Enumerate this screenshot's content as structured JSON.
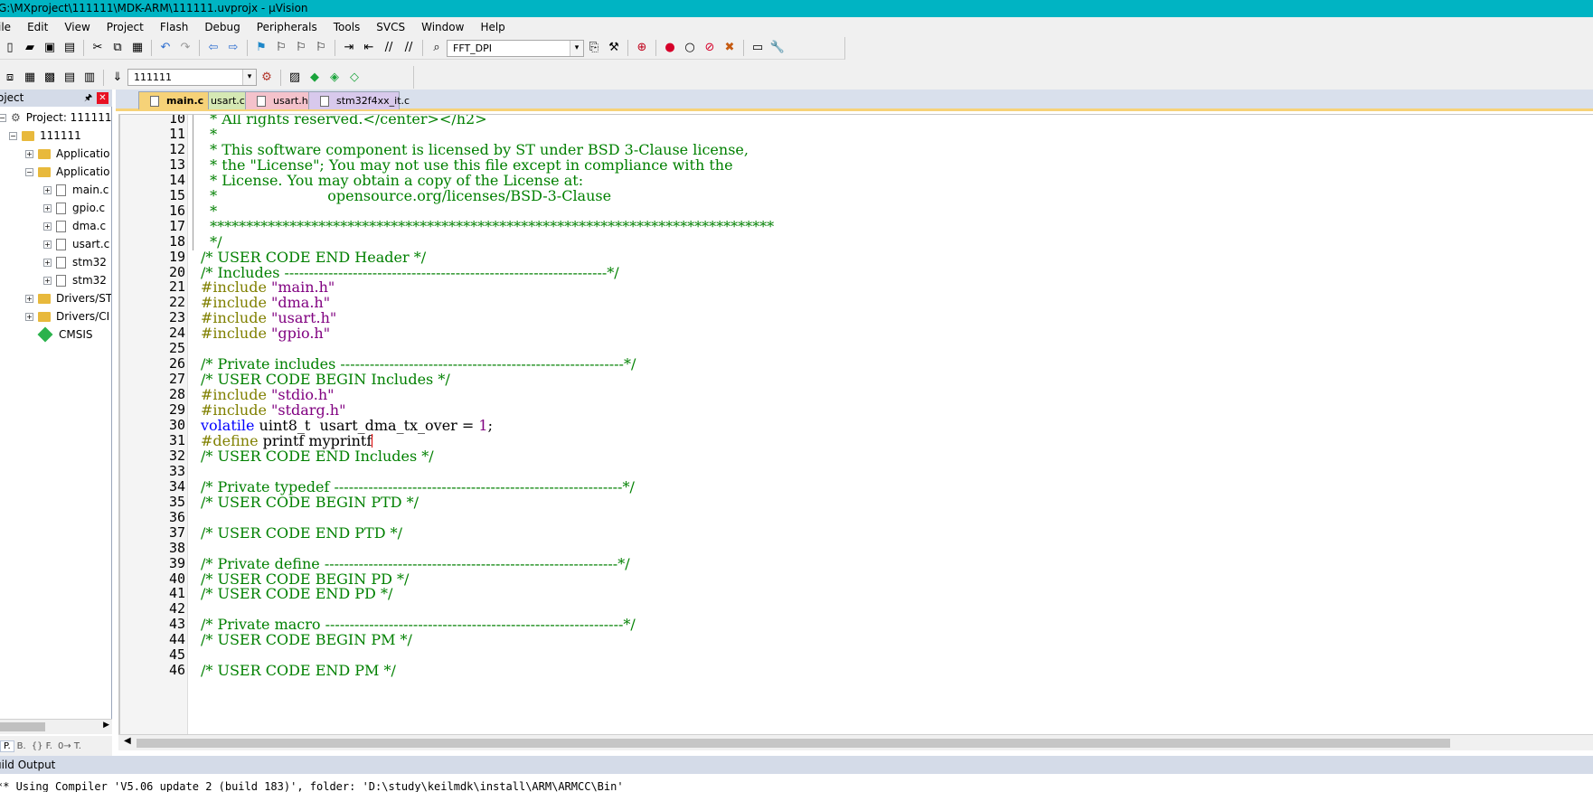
{
  "window": {
    "title": "G:\\MXproject\\111111\\MDK-ARM\\111111.uvprojx - µVision"
  },
  "menu": [
    "ile",
    "Edit",
    "View",
    "Project",
    "Flash",
    "Debug",
    "Peripherals",
    "Tools",
    "SVCS",
    "Window",
    "Help"
  ],
  "toolbar1": {
    "icons_left": [
      "new-file-icon",
      "open-icon",
      "save-icon",
      "save-all-icon",
      "cut-icon",
      "copy-icon",
      "paste-icon",
      "undo-icon",
      "redo-icon",
      "nav-back-icon",
      "nav-forward-icon",
      "bookmark-icon",
      "bookmark-prev-icon",
      "bookmark-next-icon",
      "bookmark-clear-icon",
      "indent-icon",
      "unindent-icon",
      "comment-icon",
      "uncomment-icon",
      "find-in-files-icon"
    ],
    "find_combo": "FFT_DPI",
    "icons_right": [
      "incremental-find-icon",
      "find-icon",
      "debug-session-icon",
      "breakpoint-icon",
      "breakpoint-disable-icon",
      "breakpoint-kill-icon",
      "breakpoint-clear-icon",
      "window-layout-icon",
      "configure-icon"
    ]
  },
  "toolbar2": {
    "icons_left": [
      "translate-icon",
      "build-icon",
      "rebuild-icon",
      "batch-build-icon",
      "stop-build-icon",
      "download-icon"
    ],
    "target_combo": "111111",
    "icons_right": [
      "target-options-icon",
      "manage-components-icon",
      "select-pack-icon",
      "pack-installer-icon",
      "run-time-env-icon"
    ]
  },
  "project_panel": {
    "title": "oject",
    "tree": [
      {
        "label": "Project: 111111",
        "level": 0,
        "kind": "project",
        "expander": "−"
      },
      {
        "label": "111111",
        "level": 1,
        "kind": "folder",
        "expander": "−"
      },
      {
        "label": "Applicatio",
        "level": 2,
        "kind": "folder",
        "expander": "+"
      },
      {
        "label": "Applicatio",
        "level": 2,
        "kind": "folder",
        "expander": "−"
      },
      {
        "label": "main.c",
        "level": 3,
        "kind": "file",
        "expander": "+"
      },
      {
        "label": "gpio.c",
        "level": 3,
        "kind": "file",
        "expander": "+"
      },
      {
        "label": "dma.c",
        "level": 3,
        "kind": "file",
        "expander": "+"
      },
      {
        "label": "usart.c",
        "level": 3,
        "kind": "file",
        "expander": "+"
      },
      {
        "label": "stm32",
        "level": 3,
        "kind": "file",
        "expander": "+"
      },
      {
        "label": "stm32",
        "level": 3,
        "kind": "file",
        "expander": "+"
      },
      {
        "label": "Drivers/STI",
        "level": 2,
        "kind": "folder",
        "expander": "+"
      },
      {
        "label": "Drivers/CI",
        "level": 2,
        "kind": "folder",
        "expander": "+"
      },
      {
        "label": "CMSIS",
        "level": 2,
        "kind": "component",
        "expander": ""
      }
    ],
    "tabs": [
      "P.",
      "B.",
      "{} F.",
      "0→ T."
    ]
  },
  "editor_tabs": [
    {
      "label": "main.c",
      "active": true,
      "color": "#f6d278"
    },
    {
      "label": "usart.c",
      "active": false,
      "color": "#d5e8b4"
    },
    {
      "label": "usart.h",
      "active": false,
      "color": "#f4c2cb"
    },
    {
      "label": "stm32f4xx_it.c",
      "active": false,
      "color": "#d8c9ec"
    }
  ],
  "code_lines": [
    {
      "n": "10",
      "spans": [
        {
          "c": "comment",
          "t": "  * All rights reserved.</center></h2>"
        }
      ]
    },
    {
      "n": "11",
      "spans": [
        {
          "c": "comment",
          "t": "  *"
        }
      ]
    },
    {
      "n": "12",
      "spans": [
        {
          "c": "comment",
          "t": "  * This software component is licensed by ST under BSD 3-Clause license,"
        }
      ]
    },
    {
      "n": "13",
      "spans": [
        {
          "c": "comment",
          "t": "  * the \"License\"; You may not use this file except in compliance with the"
        }
      ]
    },
    {
      "n": "14",
      "spans": [
        {
          "c": "comment",
          "t": "  * License. You may obtain a copy of the License at:"
        }
      ]
    },
    {
      "n": "15",
      "spans": [
        {
          "c": "comment",
          "t": "  *                        opensource.org/licenses/BSD-3-Clause"
        }
      ]
    },
    {
      "n": "16",
      "spans": [
        {
          "c": "comment",
          "t": "  *"
        }
      ]
    },
    {
      "n": "17",
      "spans": [
        {
          "c": "comment",
          "t": "  ******************************************************************************"
        }
      ]
    },
    {
      "n": "18",
      "spans": [
        {
          "c": "comment",
          "t": "  */"
        }
      ]
    },
    {
      "n": "19",
      "spans": [
        {
          "c": "comment",
          "t": "/* USER CODE END Header */"
        }
      ]
    },
    {
      "n": "20",
      "spans": [
        {
          "c": "comment",
          "t": "/* Includes ------------------------------------------------------------------*/"
        }
      ]
    },
    {
      "n": "21",
      "spans": [
        {
          "c": "pre",
          "t": "#include "
        },
        {
          "c": "str",
          "t": "\"main.h\""
        }
      ]
    },
    {
      "n": "22",
      "spans": [
        {
          "c": "pre",
          "t": "#include "
        },
        {
          "c": "str",
          "t": "\"dma.h\""
        }
      ]
    },
    {
      "n": "23",
      "spans": [
        {
          "c": "pre",
          "t": "#include "
        },
        {
          "c": "str",
          "t": "\"usart.h\""
        }
      ]
    },
    {
      "n": "24",
      "spans": [
        {
          "c": "pre",
          "t": "#include "
        },
        {
          "c": "str",
          "t": "\"gpio.h\""
        }
      ]
    },
    {
      "n": "25",
      "spans": []
    },
    {
      "n": "26",
      "spans": [
        {
          "c": "comment",
          "t": "/* Private includes ----------------------------------------------------------*/"
        }
      ]
    },
    {
      "n": "27",
      "spans": [
        {
          "c": "comment",
          "t": "/* USER CODE BEGIN Includes */"
        }
      ]
    },
    {
      "n": "28",
      "spans": [
        {
          "c": "pre",
          "t": "#include "
        },
        {
          "c": "str",
          "t": "\"stdio.h\""
        }
      ]
    },
    {
      "n": "29",
      "spans": [
        {
          "c": "pre",
          "t": "#include "
        },
        {
          "c": "str",
          "t": "\"stdarg.h\""
        }
      ]
    },
    {
      "n": "30",
      "spans": [
        {
          "c": "kw",
          "t": "volatile"
        },
        {
          "c": "plain",
          "t": " uint8_t  usart_dma_tx_over = "
        },
        {
          "c": "num",
          "t": "1"
        },
        {
          "c": "plain",
          "t": ";"
        }
      ]
    },
    {
      "n": "31",
      "spans": [
        {
          "c": "pre",
          "t": "#define"
        },
        {
          "c": "plain",
          "t": " printf myprintf"
        }
      ],
      "caret": true
    },
    {
      "n": "32",
      "spans": [
        {
          "c": "comment",
          "t": "/* USER CODE END Includes */"
        }
      ]
    },
    {
      "n": "33",
      "spans": []
    },
    {
      "n": "34",
      "spans": [
        {
          "c": "comment",
          "t": "/* Private typedef -----------------------------------------------------------*/"
        }
      ]
    },
    {
      "n": "35",
      "spans": [
        {
          "c": "comment",
          "t": "/* USER CODE BEGIN PTD */"
        }
      ]
    },
    {
      "n": "36",
      "spans": []
    },
    {
      "n": "37",
      "spans": [
        {
          "c": "comment",
          "t": "/* USER CODE END PTD */"
        }
      ]
    },
    {
      "n": "38",
      "spans": []
    },
    {
      "n": "39",
      "spans": [
        {
          "c": "comment",
          "t": "/* Private define ------------------------------------------------------------*/"
        }
      ]
    },
    {
      "n": "40",
      "spans": [
        {
          "c": "comment",
          "t": "/* USER CODE BEGIN PD */"
        }
      ]
    },
    {
      "n": "41",
      "spans": [
        {
          "c": "comment",
          "t": "/* USER CODE END PD */"
        }
      ]
    },
    {
      "n": "42",
      "spans": []
    },
    {
      "n": "43",
      "spans": [
        {
          "c": "comment",
          "t": "/* Private macro -------------------------------------------------------------*/"
        }
      ]
    },
    {
      "n": "44",
      "spans": [
        {
          "c": "comment",
          "t": "/* USER CODE BEGIN PM */"
        }
      ]
    },
    {
      "n": "45",
      "spans": []
    },
    {
      "n": "46",
      "spans": [
        {
          "c": "comment",
          "t": "/* USER CODE END PM */"
        }
      ]
    }
  ],
  "build_output": {
    "title": "uild Output",
    "text": "** Using Compiler 'V5.06 update 2 (build 183)', folder: 'D:\\study\\keilmdk\\install\\ARM\\ARMCC\\Bin'"
  },
  "colors": {
    "title_bar": "#00b4c3",
    "comment": "#008000",
    "preprocessor": "#808000",
    "string": "#800080",
    "keyword": "#0000ff"
  }
}
